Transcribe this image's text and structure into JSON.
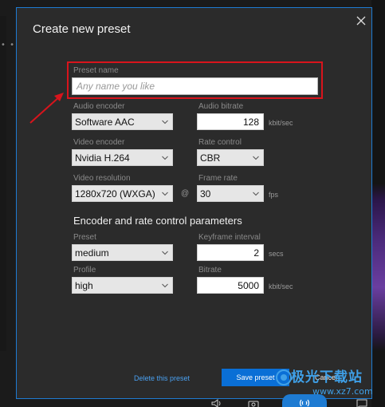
{
  "dialog": {
    "title": "Create new preset",
    "preset_name": {
      "label": "Preset name",
      "placeholder": "Any name you like",
      "value": ""
    },
    "audio_encoder": {
      "label": "Audio encoder",
      "value": "Software AAC"
    },
    "audio_bitrate": {
      "label": "Audio bitrate",
      "value": "128",
      "unit": "kbit/sec"
    },
    "video_encoder": {
      "label": "Video encoder",
      "value": "Nvidia H.264"
    },
    "rate_control": {
      "label": "Rate control",
      "value": "CBR"
    },
    "video_resolution": {
      "label": "Video resolution",
      "value": "1280x720 (WXGA)"
    },
    "at_sign": "@",
    "frame_rate": {
      "label": "Frame rate",
      "value": "30",
      "unit": "fps"
    },
    "section_heading": "Encoder and rate control parameters",
    "preset": {
      "label": "Preset",
      "value": "medium"
    },
    "keyframe_interval": {
      "label": "Keyframe interval",
      "value": "2",
      "unit": "secs"
    },
    "profile": {
      "label": "Profile",
      "value": "high"
    },
    "bitrate": {
      "label": "Bitrate",
      "value": "5000",
      "unit": "kbit/sec"
    },
    "delete_label": "Delete this preset",
    "save_label": "Save preset",
    "cancel_label": "Cancel"
  },
  "background": {
    "dots": "• •"
  },
  "watermark": {
    "line1": "极光下载站",
    "line2": "www.xz7.com"
  },
  "icons": [
    "close-icon",
    "chevron-down-icon",
    "annotation-arrow-icon",
    "speaker-icon",
    "camera-icon",
    "broadcast-icon",
    "chat-icon"
  ],
  "colors": {
    "accent": "#0a6fd6",
    "highlight": "#d8141c",
    "dialog_border": "#1e7bd2",
    "dialog_bg": "#2b2b2b"
  }
}
